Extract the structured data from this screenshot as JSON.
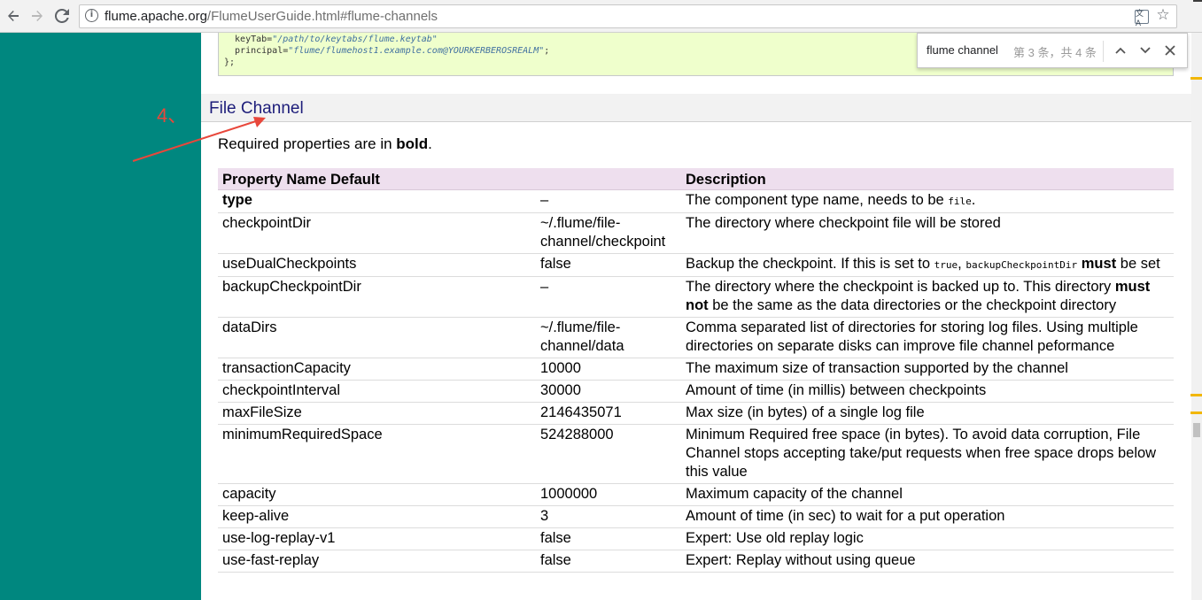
{
  "browser": {
    "url_host": "flume.apache.org",
    "url_path": "/FlumeUserGuide.html#flume-channels"
  },
  "find_bar": {
    "query": "flume channel",
    "match_count": "第 3 条，共 4 条"
  },
  "code_block": {
    "line1_key": "  keyTab=",
    "line1_val": "\"/path/to/keytabs/flume.keytab\"",
    "line2_key": "  principal=",
    "line2_val": "\"flume/flumehost1.example.com@YOURKERBEROSREALM\"",
    "line2_end": ";",
    "line3": "};"
  },
  "annotation": {
    "number": "4、"
  },
  "section": {
    "title": "File Channel"
  },
  "intro": {
    "prefix": "Required properties are in ",
    "bold": "bold",
    "suffix": "."
  },
  "table": {
    "headers": [
      "Property Name",
      "Default",
      "Description"
    ],
    "rows": [
      {
        "name": "type",
        "default": "–",
        "desc": "The component type name, needs to be ",
        "code": "file",
        "desc_end": "."
      },
      {
        "name": "checkpointDir",
        "default": "~/.flume/file-channel/checkpoint",
        "desc": "The directory where checkpoint file will be stored"
      },
      {
        "name": "useDualCheckpoints",
        "default": "false",
        "desc": "Backup the checkpoint. If this is set to ",
        "code1": "true",
        "sep": ", ",
        "code2": "backupCheckpointDir",
        "must": "must",
        "desc_end": " be set"
      },
      {
        "name": "backupCheckpointDir",
        "default": "–",
        "desc": "The directory where the checkpoint is backed up to. This directory ",
        "must": "must not",
        "desc_end": " be the same as the data directories or the checkpoint directory"
      },
      {
        "name": "dataDirs",
        "default": "~/.flume/file-channel/data",
        "desc": "Comma separated list of directories for storing log files. Using multiple directories on separate disks can improve file channel peformance"
      },
      {
        "name": "transactionCapacity",
        "default": "10000",
        "desc": "The maximum size of transaction supported by the channel"
      },
      {
        "name": "checkpointInterval",
        "default": "30000",
        "desc": "Amount of time (in millis) between checkpoints"
      },
      {
        "name": "maxFileSize",
        "default": "2146435071",
        "desc": "Max size (in bytes) of a single log file"
      },
      {
        "name": "minimumRequiredSpace",
        "default": "524288000",
        "desc": "Minimum Required free space (in bytes). To avoid data corruption, File Channel stops accepting take/put requests when free space drops below this value"
      },
      {
        "name": "capacity",
        "default": "1000000",
        "desc": "Maximum capacity of the channel"
      },
      {
        "name": "keep-alive",
        "default": "3",
        "desc": "Amount of time (in sec) to wait for a put operation"
      },
      {
        "name": "use-log-replay-v1",
        "default": "false",
        "desc": "Expert: Use old replay logic"
      },
      {
        "name": "use-fast-replay",
        "default": "false",
        "desc": "Expert: Replay without using queue"
      }
    ]
  },
  "colors": {
    "sidebar": "#00877f",
    "table_header": "#eedfee",
    "code_bg": "#efffcc",
    "section_title": "#1d1d7a",
    "annotation": "#e8473b",
    "scroll_marker": "#f2b705"
  },
  "icons": [
    "back-icon",
    "forward-icon",
    "reload-icon",
    "info-icon",
    "translate-icon",
    "star-icon",
    "find-prev-icon",
    "find-next-icon",
    "find-close-icon"
  ]
}
